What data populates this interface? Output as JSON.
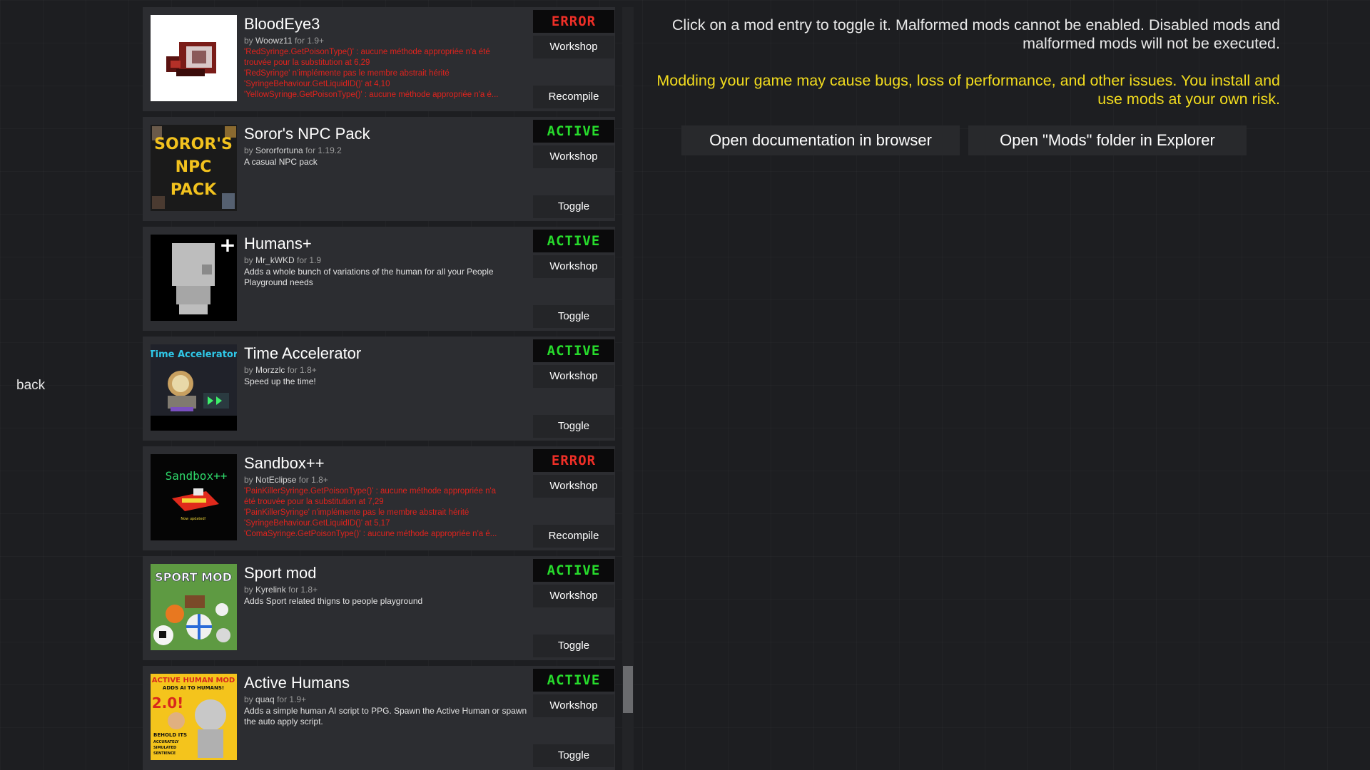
{
  "back_label": "back",
  "info_text": "Click on a mod entry to toggle it. Malformed mods cannot be enabled. Disabled mods and malformed mods will not be executed.",
  "warning_text": "Modding your game may cause bugs, loss of performance, and other issues. You install and use mods at your own risk.",
  "buttons": {
    "open_docs": "Open documentation in browser",
    "open_folder": "Open \"Mods\" folder in Explorer"
  },
  "colors": {
    "active": "#27dc2c",
    "error": "#ee2f27",
    "warning": "#f2dc1e"
  },
  "mods": [
    {
      "title": "BloodEye3",
      "by": "by",
      "author": "Woowz11",
      "version": "for 1.9+",
      "status": "ERROR",
      "workshop": "Workshop",
      "action": "Recompile",
      "errors": [
        "'RedSyringe.GetPoisonType()' : aucune méthode appropriée n'a été",
        "trouvée pour la substitution at 6,29",
        "'RedSyringe' n'implémente pas le membre abstrait hérité",
        "'SyringeBehaviour.GetLiquidID()' at 4,10",
        "'YellowSyringe.GetPoisonType()' : aucune méthode appropriée n'a é..."
      ]
    },
    {
      "title": "Soror's NPC Pack",
      "by": "by",
      "author": "Sororfortuna",
      "version": "for 1.19.2",
      "status": "ACTIVE",
      "workshop": "Workshop",
      "action": "Toggle",
      "description": "A casual NPC pack",
      "thumb_lines": [
        "SOROR'S",
        "NPC",
        "PACK"
      ]
    },
    {
      "title": "Humans+",
      "by": "by",
      "author": "Mr_kWKD",
      "version": "for 1.9",
      "status": "ACTIVE",
      "workshop": "Workshop",
      "action": "Toggle",
      "description": "Adds a whole bunch of variations of the human for all your People Playground needs",
      "thumb_plus": "+"
    },
    {
      "title": "Time Accelerator",
      "by": "by",
      "author": "Morzzlc",
      "version": "for 1.8+",
      "status": "ACTIVE",
      "workshop": "Workshop",
      "action": "Toggle",
      "description": "Speed up the time!",
      "thumb_caption": "Time Accelerator"
    },
    {
      "title": "Sandbox++",
      "by": "by",
      "author": "NotEclipse",
      "version": "for 1.8+",
      "status": "ERROR",
      "workshop": "Workshop",
      "action": "Recompile",
      "thumb_caption": "Sandbox++",
      "thumb_sub": "Now updated!",
      "errors": [
        "'PainKillerSyringe.GetPoisonType()' : aucune méthode appropriée n'a",
        "été trouvée pour la substitution at 7,29",
        "'PainKillerSyringe' n'implémente pas le membre abstrait hérité",
        "'SyringeBehaviour.GetLiquidID()' at 5,17",
        "'ComaSyringe.GetPoisonType()' : aucune méthode appropriée n'a é..."
      ]
    },
    {
      "title": "Sport mod",
      "by": "by",
      "author": "Kyrelink",
      "version": "for 1.8+",
      "status": "ACTIVE",
      "workshop": "Workshop",
      "action": "Toggle",
      "description": "Adds Sport related thigns to people playground",
      "thumb_caption": "SPORT MOD"
    },
    {
      "title": "Active Humans",
      "by": "by",
      "author": "quaq",
      "version": "for 1.9+",
      "status": "ACTIVE",
      "workshop": "Workshop",
      "action": "Toggle",
      "description": "Adds a simple human AI script to PPG. Spawn the Active Human or spawn the auto apply script.",
      "thumb_caption": "ACTIVE HUMAN MOD",
      "thumb_sub": "ADDS AI TO HUMANS!",
      "thumb_version": "2.0!",
      "thumb_lines": [
        "BEHOLD ITS",
        "ACCURATELY",
        "SIMULATED",
        "SENTIENCE"
      ]
    }
  ]
}
